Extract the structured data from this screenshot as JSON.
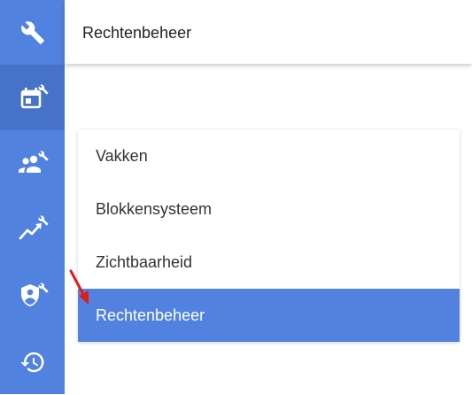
{
  "header": {
    "title": "Rechtenbeheer"
  },
  "sidebar": {
    "items": [
      {
        "icon": "wrench-icon",
        "active": false
      },
      {
        "icon": "calendar-wrench-icon",
        "active": true
      },
      {
        "icon": "people-wrench-icon",
        "active": false
      },
      {
        "icon": "trending-wrench-icon",
        "active": false
      },
      {
        "icon": "shield-user-wrench-icon",
        "active": false
      },
      {
        "icon": "history-icon",
        "active": false
      }
    ]
  },
  "menu": {
    "items": [
      {
        "label": "Vakken",
        "selected": false
      },
      {
        "label": "Blokkensysteem",
        "selected": false
      },
      {
        "label": "Zichtbaarheid",
        "selected": false
      },
      {
        "label": "Rechtenbeheer",
        "selected": true
      }
    ]
  },
  "colors": {
    "sidebar": "#5282e0",
    "sidebar_active": "#4673c9",
    "selected": "#5282e0",
    "annotation_arrow": "#e01b1b"
  }
}
